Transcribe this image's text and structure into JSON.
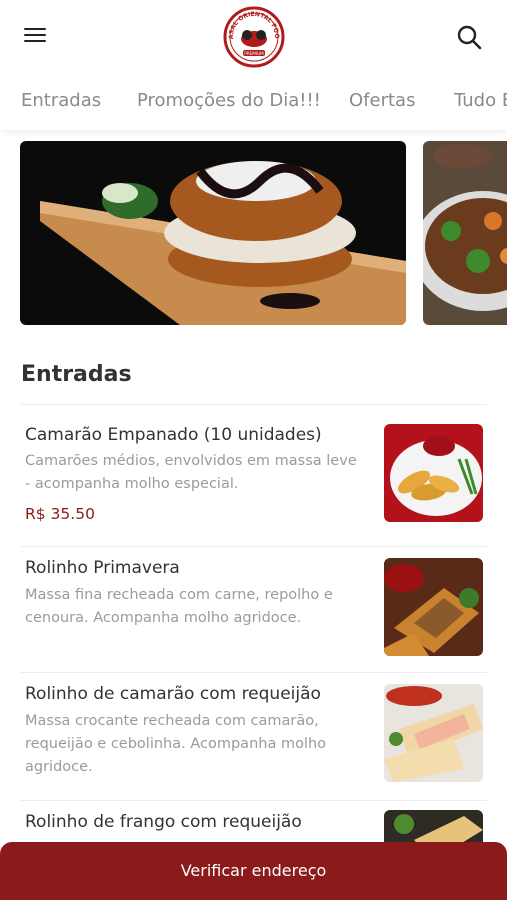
{
  "header": {
    "logo_text_top": "CASAL ORIENTAL FOOD",
    "logo_text_bottom": "PREMIUM"
  },
  "categories": [
    "Entradas",
    "Promoções do Dia!!!",
    "Ofertas",
    "Tudo E"
  ],
  "section": {
    "title": "Entradas"
  },
  "items": [
    {
      "name": "Camarão Empanado (10 unidades)",
      "desc_lines": [
        "Camarões médios, envolvidos em massa leve",
        "- acompanha molho especial."
      ],
      "price": "R$ 35.50"
    },
    {
      "name": "Rolinho Primavera",
      "desc_lines": [
        "Massa fina recheada com carne, repolho e",
        "cenoura. Acompanha molho agridoce."
      ]
    },
    {
      "name": "Rolinho de camarão com requeijão",
      "desc_lines": [
        "Massa crocante recheada com camarão,",
        "requeijão e cebolinha. Acompanha molho",
        "agridoce."
      ]
    },
    {
      "name": "Rolinho de frango com requeijão",
      "desc_lines": []
    }
  ],
  "bottom_button": {
    "label": "Verificar endereço"
  },
  "colors": {
    "accent": "#8b1a1a",
    "text": "#333333",
    "muted": "#9b9b9b"
  }
}
